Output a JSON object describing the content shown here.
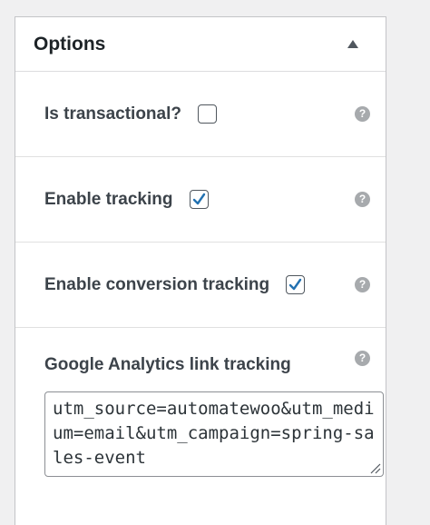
{
  "panel": {
    "title": "Options"
  },
  "rows": [
    {
      "label": "Is transactional?",
      "checked": false
    },
    {
      "label": "Enable tracking",
      "checked": true
    },
    {
      "label": "Enable conversion tracking",
      "checked": true
    }
  ],
  "ga_tracking": {
    "label": "Google Analytics link tracking",
    "value": "utm_source=automatewoo&utm_medium=email&utm_campaign=spring-sales-event"
  },
  "help_icon_glyph": "?",
  "colors": {
    "check_accent": "#2271b1",
    "help_icon": "#a7aaad"
  }
}
